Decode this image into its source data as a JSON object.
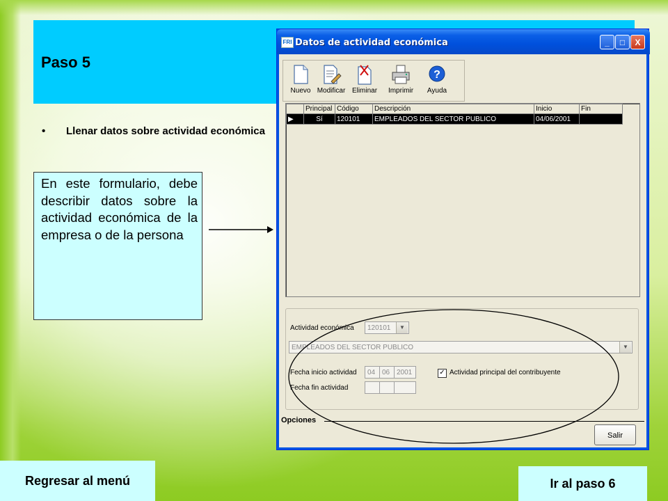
{
  "slide": {
    "title": "Paso 5",
    "bullet_marker": "•",
    "bullet_text": "Llenar datos sobre actividad económica",
    "note": "En este formulario, debe describir datos sobre la actividad económica de la empresa o de la persona"
  },
  "dialog": {
    "title": "Datos de actividad económica",
    "app_icon": "FRI",
    "window_buttons": {
      "minimize": "_",
      "maximize": "□",
      "close": "X"
    },
    "toolbar": [
      {
        "label": "Nuevo",
        "icon": "new-document-icon"
      },
      {
        "label": "Modificar",
        "icon": "edit-document-icon"
      },
      {
        "label": "Eliminar",
        "icon": "delete-document-icon"
      },
      {
        "label": "Imprimir",
        "icon": "printer-icon"
      },
      {
        "label": "Ayuda",
        "icon": "help-icon"
      }
    ],
    "grid": {
      "columns": [
        "Principal",
        "Código",
        "Descripción",
        "Inicio",
        "Fin"
      ],
      "rows": [
        {
          "indicator": "▶",
          "principal": "Sí",
          "codigo": "120101",
          "descripcion": "EMPLEADOS DEL SECTOR PUBLICO",
          "inicio": "04/06/2001",
          "fin": ""
        }
      ]
    },
    "form": {
      "actividad_label": "Actividad económica",
      "actividad_code": "120101",
      "actividad_desc": "EMPLEADOS DEL SECTOR PUBLICO",
      "fecha_inicio_label": "Fecha inicio actividad",
      "fecha_inicio_dd": "04",
      "fecha_inicio_mm": "06",
      "fecha_inicio_yyyy": "2001",
      "principal_checkbox_label": "Actividad principal del contribuyente",
      "principal_checked": true,
      "fecha_fin_label": "Fecha fin actividad",
      "check_mark": "✓",
      "dropdown_arrow": "▼"
    },
    "opciones_label": "Opciones",
    "salir_label": "Salir"
  },
  "nav": {
    "back": "Regresar al menú",
    "next": "Ir al paso 6"
  },
  "colors": {
    "title_band": "#00ccff",
    "note_bg": "#ccffff",
    "nav_bg": "#ccffff",
    "selected_row": "#000000"
  }
}
